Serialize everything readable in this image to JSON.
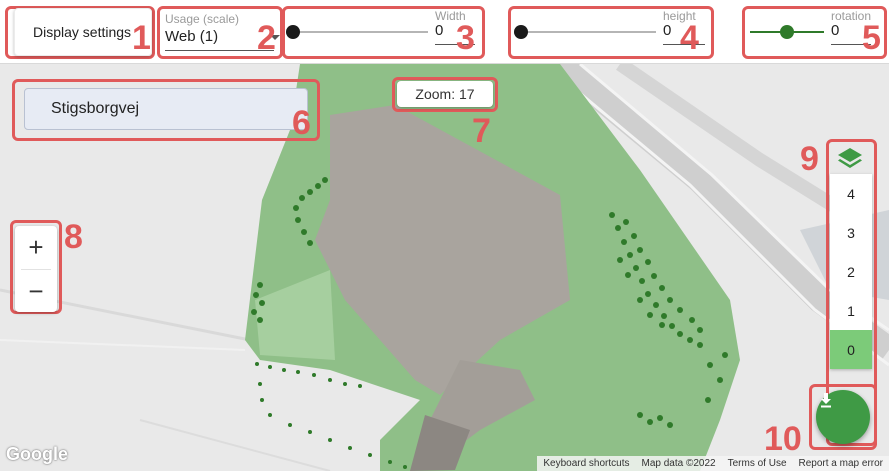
{
  "toolbar": {
    "display_settings_label": "Display settings",
    "usage": {
      "label": "Usage (scale)",
      "value": "Web (1)"
    },
    "width": {
      "label": "Width",
      "value": "0"
    },
    "height": {
      "label": "height",
      "value": "0"
    },
    "rotation": {
      "label": "rotation",
      "value": "0"
    }
  },
  "map": {
    "search_value": "Stigsborgvej",
    "zoom_label": "Zoom: 17",
    "zoom_in_label": "+",
    "zoom_out_label": "−",
    "layers": [
      "4",
      "3",
      "2",
      "1",
      "0"
    ],
    "active_layer": "0",
    "attribution": {
      "logo": "Google",
      "keyboard_shortcuts": "Keyboard shortcuts",
      "map_data": "Map data ©2022",
      "terms": "Terms of Use",
      "report": "Report a map error"
    }
  },
  "annotations": [
    "1",
    "2",
    "3",
    "4",
    "5",
    "6",
    "7",
    "8",
    "9",
    "10"
  ],
  "colors": {
    "annotation": "#e05a5a",
    "accent_green": "#3f9a45",
    "active_layer_bg": "#7ccb79",
    "park_green": "#8fbf88",
    "building": "#a9a49e"
  },
  "icons": {
    "layers": "layers-icon",
    "download": "download-icon"
  }
}
